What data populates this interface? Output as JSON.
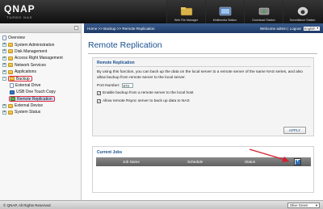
{
  "header": {
    "logo": "QNAP",
    "logo_sub": "TURBO NAS",
    "stations": [
      {
        "label": "Web File Manager",
        "icon": "web-file-manager-icon"
      },
      {
        "label": "Multimedia Station",
        "icon": "multimedia-station-icon"
      },
      {
        "label": "Download Station",
        "icon": "download-station-icon"
      },
      {
        "label": "Surveillance Station",
        "icon": "surveillance-station-icon"
      }
    ]
  },
  "sidebar": {
    "collapse_glyph": "-",
    "items": [
      {
        "label": "Overview",
        "toggle": "",
        "icon": "page"
      },
      {
        "label": "System Administration",
        "toggle": "+",
        "icon": "folder"
      },
      {
        "label": "Disk Management",
        "toggle": "+",
        "icon": "folder"
      },
      {
        "label": "Access Right Management",
        "toggle": "+",
        "icon": "folder"
      },
      {
        "label": "Network Services",
        "toggle": "+",
        "icon": "folder"
      },
      {
        "label": "Applications",
        "toggle": "+",
        "icon": "folder"
      },
      {
        "label": "Backup",
        "toggle": "-",
        "icon": "folder"
      },
      {
        "label": "External Drive",
        "toggle": "",
        "icon": "page"
      },
      {
        "label": "USB One Touch Copy",
        "toggle": "",
        "icon": "usb"
      },
      {
        "label": "Remote Replication",
        "toggle": "",
        "icon": "rr"
      },
      {
        "label": "External Device",
        "toggle": "+",
        "icon": "folder"
      },
      {
        "label": "System Status",
        "toggle": "+",
        "icon": "folder"
      }
    ]
  },
  "breadcrumb": "Home >> Backup >> Remote Replication",
  "user_links": "Welcome admin | Logout",
  "language": "English",
  "page_title": "Remote Replication",
  "replication_panel": {
    "legend": "Remote Replication",
    "description": "By using this function, you can back up the data on the local server to a remote server of the same NAS series, and also allow backup from remote server to the local server.",
    "port_label": "Port Number:",
    "port_value": "873",
    "options": [
      {
        "label": "Enable backup from a remote server to the local host",
        "checked": true
      },
      {
        "label": "Allow remote Rsync server to back up data to NAS",
        "checked": true
      }
    ],
    "apply_label": "APPLY"
  },
  "jobs_panel": {
    "legend": "Current Jobs",
    "columns": [
      "Job Name",
      "Schedule",
      "Status"
    ],
    "add_glyph": "+"
  },
  "footer": {
    "copyright": "© QNAP, All Rights Reserved",
    "theme": "Olive Green"
  },
  "colors": {
    "accent": "#1a4f8f",
    "highlight_border": "#e0283a",
    "breadcrumb_bg": "#2a4a7a"
  }
}
